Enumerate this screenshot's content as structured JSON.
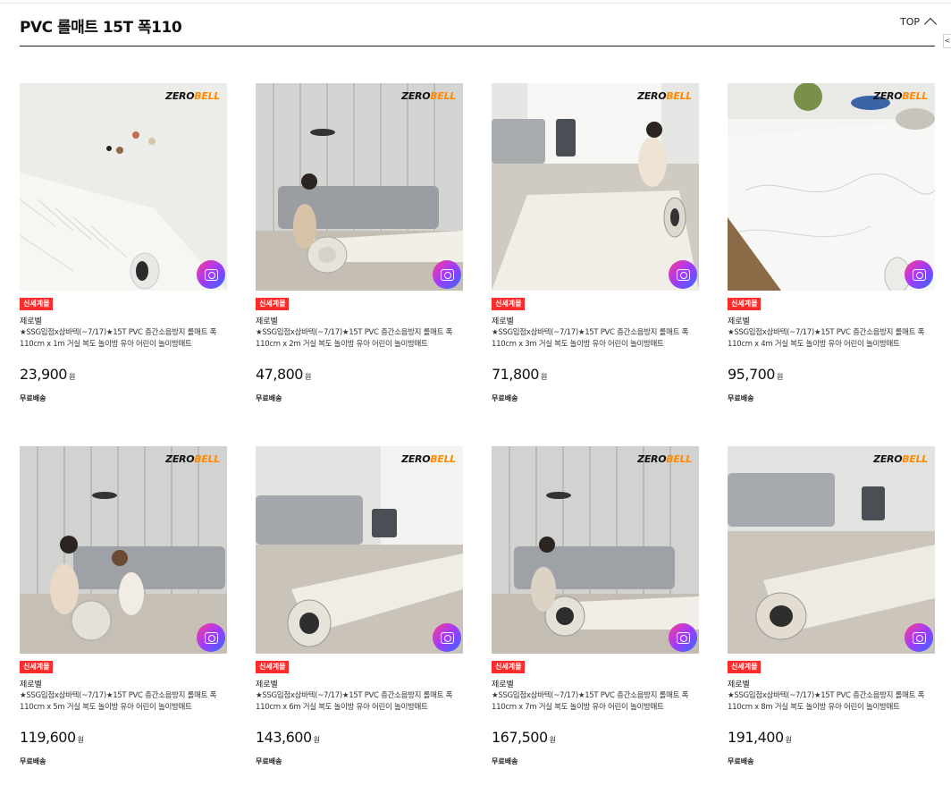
{
  "header": {
    "title": "PVC 롤매트 15T 폭110",
    "top_label": "TOP",
    "side_label": "<"
  },
  "brand": {
    "prefix": "ZERO",
    "suffix": "BELL"
  },
  "products": [
    {
      "badge": "신세계몰",
      "seller": "제로벨",
      "name": "★SSG입점x삼바텍(~7/17)★15T PVC 층간소음방지 롤매트 폭 110cm x 1m 거실 복도 놀이방 유아 어린이 놀이방매트",
      "price": "23,900",
      "currency": "원",
      "shipping": "무료배송"
    },
    {
      "badge": "신세계몰",
      "seller": "제로벨",
      "name": "★SSG입점x삼바텍(~7/17)★15T PVC 층간소음방지 롤매트 폭 110cm x 2m 거실 복도 놀이방 유아 어린이 놀이방매트",
      "price": "47,800",
      "currency": "원",
      "shipping": "무료배송"
    },
    {
      "badge": "신세계몰",
      "seller": "제로벨",
      "name": "★SSG입점x삼바텍(~7/17)★15T PVC 층간소음방지 롤매트 폭 110cm x 3m 거실 복도 놀이방 유아 어린이 놀이방매트",
      "price": "71,800",
      "currency": "원",
      "shipping": "무료배송"
    },
    {
      "badge": "신세계몰",
      "seller": "제로벨",
      "name": "★SSG입점x삼바텍(~7/17)★15T PVC 층간소음방지 롤매트 폭 110cm x 4m 거실 복도 놀이방 유아 어린이 놀이방매트",
      "price": "95,700",
      "currency": "원",
      "shipping": "무료배송"
    },
    {
      "badge": "신세계몰",
      "seller": "제로벨",
      "name": "★SSG입점x삼바텍(~7/17)★15T PVC 층간소음방지 롤매트 폭 110cm x 5m 거실 복도 놀이방 유아 어린이 놀이방매트",
      "price": "119,600",
      "currency": "원",
      "shipping": "무료배송"
    },
    {
      "badge": "신세계몰",
      "seller": "제로벨",
      "name": "★SSG입점x삼바텍(~7/17)★15T PVC 층간소음방지 롤매트 폭 110cm x 6m 거실 복도 놀이방 유아 어린이 놀이방매트",
      "price": "143,600",
      "currency": "원",
      "shipping": "무료배송"
    },
    {
      "badge": "신세계몰",
      "seller": "제로벨",
      "name": "★SSG입점x삼바텍(~7/17)★15T PVC 층간소음방지 롤매트 폭 110cm x 7m 거실 복도 놀이방 유아 어린이 놀이방매트",
      "price": "167,500",
      "currency": "원",
      "shipping": "무료배송"
    },
    {
      "badge": "신세계몰",
      "seller": "제로벨",
      "name": "★SSG입점x삼바텍(~7/17)★15T PVC 층간소음방지 롤매트 폭 110cm x 8m 거실 복도 놀이방 유아 어린이 놀이방매트",
      "price": "191,400",
      "currency": "원",
      "shipping": "무료배송"
    }
  ]
}
